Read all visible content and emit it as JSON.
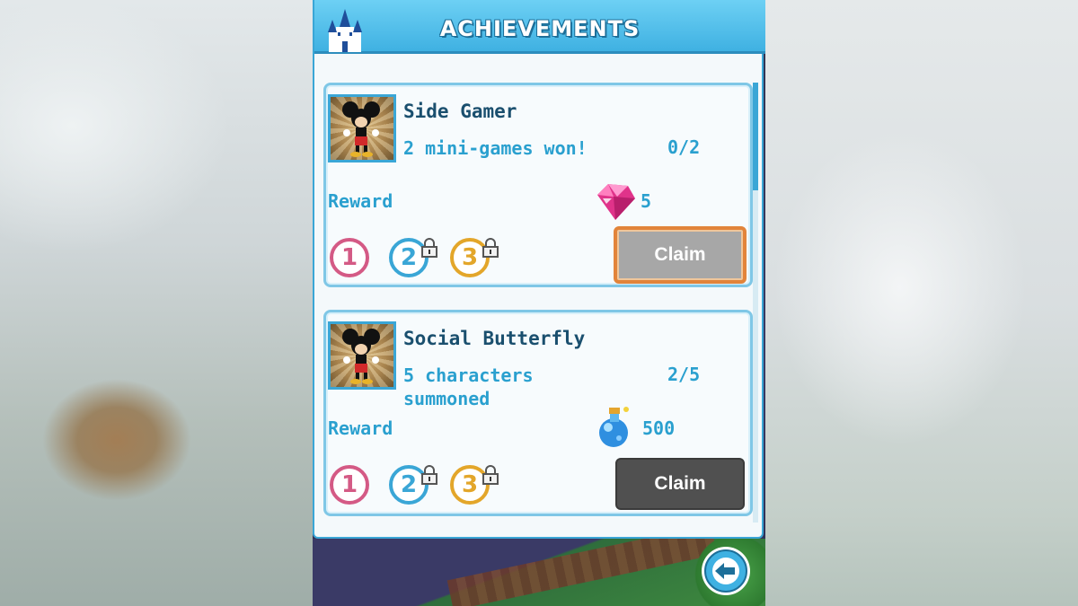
{
  "header": {
    "title": "ACHIEVEMENTS"
  },
  "achievements": [
    {
      "name": "Side Gamer",
      "description": "2 mini-games won!",
      "progress": "0/2",
      "reward_label": "Reward",
      "reward_amount": "5",
      "reward_icon": "gem-icon",
      "tiers": [
        "1",
        "2",
        "3"
      ],
      "claim_label": "Claim",
      "claim_state": "selected"
    },
    {
      "name": "Social Butterfly",
      "description": "5 characters summoned",
      "progress": "2/5",
      "reward_label": "Reward",
      "reward_amount": "500",
      "reward_icon": "magic-potion-icon",
      "tiers": [
        "1",
        "2",
        "3"
      ],
      "claim_label": "Claim",
      "claim_state": "normal"
    }
  ],
  "colors": {
    "accent": "#3aa6d6",
    "title_bar": "#3fb1e2",
    "text_dark": "#1a4f6e",
    "text_blue": "#2aa0cf",
    "tier1": "#d45a85",
    "tier2": "#3aa6d6",
    "tier3": "#e3a62a",
    "claim_highlight": "#e2843a"
  },
  "icons": {
    "back": "back-arrow-icon",
    "header": "castle-icon"
  }
}
